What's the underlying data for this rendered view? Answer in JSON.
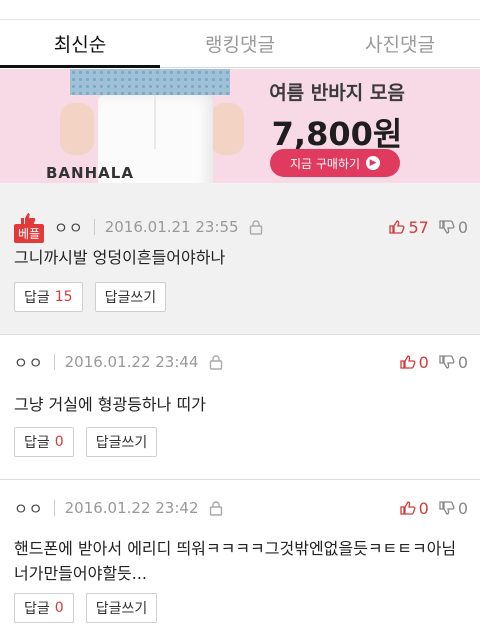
{
  "tabs": [
    {
      "label": "최신순",
      "active": true
    },
    {
      "label": "랭킹댓글",
      "active": false
    },
    {
      "label": "사진댓글",
      "active": false
    }
  ],
  "banner": {
    "brand": "BANHALA",
    "title": "여름 반바지 모음",
    "price": "7,800원",
    "button": "지금 구매하기",
    "background": "#f8d9e6",
    "button_color": "#e03a5e"
  },
  "comments": [
    {
      "best": true,
      "badge": "베플",
      "nick": "ㅇㅇ",
      "date": "2016.01.21 23:55",
      "upvotes": "57",
      "downvotes": "0",
      "text": "그니까시발 엉덩이흔들어야하나",
      "reply_label": "답글",
      "reply_count": "15",
      "write_label": "답글쓰기"
    },
    {
      "best": false,
      "nick": "ㅇㅇ",
      "date": "2016.01.22 23:44",
      "upvotes": "0",
      "downvotes": "0",
      "text": "그냥 거실에 형광등하나 띠가",
      "reply_label": "답글",
      "reply_count": "0",
      "write_label": "답글쓰기"
    },
    {
      "best": false,
      "nick": "ㅇㅇ",
      "date": "2016.01.22 23:42",
      "upvotes": "0",
      "downvotes": "0",
      "text": "핸드폰에 받아서 에리디 띄워ㅋㅋㅋㅋ그것밖엔없을듯ㅋㅌㅌㅋ아님너가만들어야할듯...",
      "reply_label": "답글",
      "reply_count": "0",
      "write_label": "답글쓰기"
    }
  ],
  "icons": {
    "lock": "lock-icon",
    "thumb_up": "thumb-up-icon",
    "thumb_down": "thumb-down-icon"
  },
  "colors": {
    "accent_red": "#d23b3b",
    "best_badge": "#e03a3a",
    "best_background": "#f1f1f1"
  }
}
